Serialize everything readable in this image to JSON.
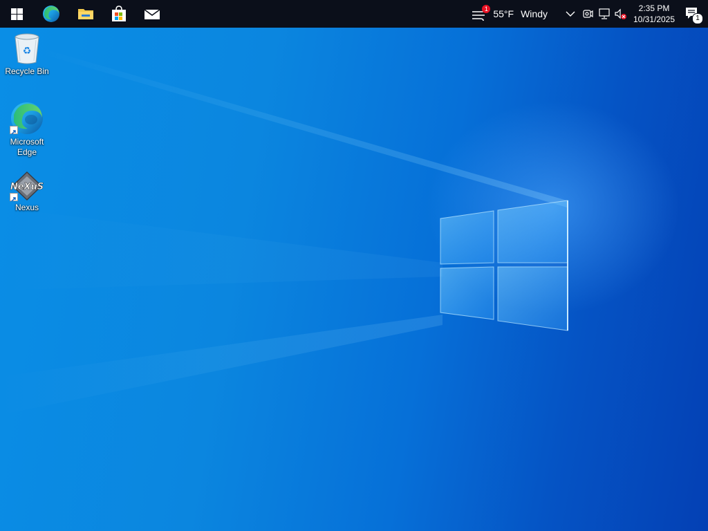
{
  "taskbar": {
    "start_icon": "windows-logo-icon",
    "pinned": [
      {
        "name": "edge",
        "icon": "edge-icon"
      },
      {
        "name": "file-explorer",
        "icon": "folder-icon"
      },
      {
        "name": "microsoft-store",
        "icon": "store-icon"
      },
      {
        "name": "mail",
        "icon": "mail-icon"
      }
    ]
  },
  "tray": {
    "weather": {
      "icon": "windy-weather-icon",
      "badge": "1",
      "temperature": "55°F",
      "condition": "Windy"
    },
    "clock": {
      "time": "2:35 PM",
      "date": "10/31/2025"
    },
    "notifications": {
      "icon": "action-center-icon",
      "count": "1"
    },
    "system_icons": [
      "chevron-up-icon",
      "meet-now-icon",
      "network-icon",
      "volume-muted-icon"
    ]
  },
  "desktop": {
    "icons": [
      {
        "label": "Recycle Bin",
        "icon": "recycle-bin-icon"
      },
      {
        "label": "Microsoft Edge",
        "icon": "edge-icon"
      },
      {
        "label": "Nexus",
        "icon": "nexus-icon"
      }
    ]
  },
  "colors": {
    "taskbar": "#0b0f1a",
    "wallpaper_light": "#0a8ee6",
    "wallpaper_dark": "#0440b4"
  }
}
